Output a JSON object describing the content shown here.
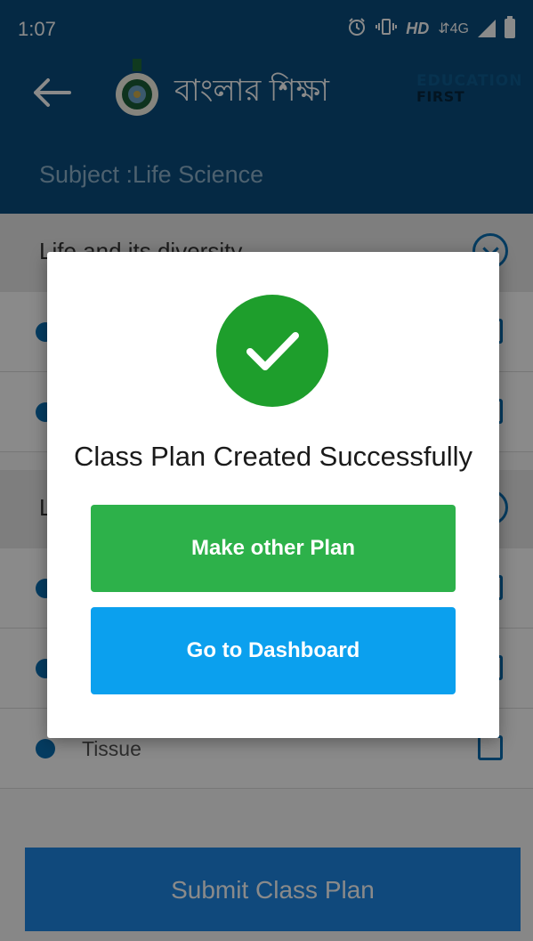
{
  "status_bar": {
    "time": "1:07",
    "hd_label": "HD",
    "network_label": "4G",
    "icons": [
      "alarm-icon",
      "vibrate-icon",
      "signal-icon",
      "battery-icon"
    ]
  },
  "app_bar": {
    "back_icon": "back-arrow-icon",
    "title": "বাংলার শিক্ষা",
    "partner_logo_line1": "EDUCATION",
    "partner_logo_line2": "FIRST",
    "subject_line": "Subject :Life Science",
    "background_color": "#0a4d7e"
  },
  "list": {
    "sections": [
      {
        "title": "Life and its diversity",
        "rows": [
          {
            "label": ""
          },
          {
            "label": ""
          }
        ]
      },
      {
        "title": "L",
        "rows": [
          {
            "label": ""
          },
          {
            "label": ""
          },
          {
            "label": "Tissue"
          }
        ]
      }
    ],
    "submit_label": "Submit Class Plan"
  },
  "dialog": {
    "icon": "check-circle-icon",
    "message": "Class Plan Created Successfully",
    "primary_button": "Make other Plan",
    "secondary_button": "Go to Dashboard",
    "colors": {
      "success": "#1e9e2c",
      "primary": "#2db14a",
      "secondary": "#0ba0ee"
    }
  }
}
